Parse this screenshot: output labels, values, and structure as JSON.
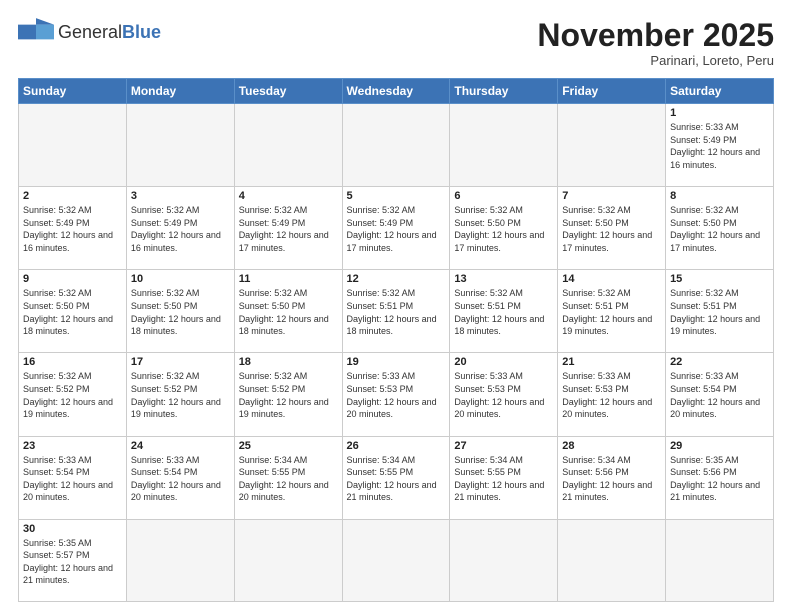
{
  "header": {
    "logo_general": "General",
    "logo_blue": "Blue",
    "month_year": "November 2025",
    "location": "Parinari, Loreto, Peru"
  },
  "weekdays": [
    "Sunday",
    "Monday",
    "Tuesday",
    "Wednesday",
    "Thursday",
    "Friday",
    "Saturday"
  ],
  "weeks": [
    [
      {
        "day": "",
        "info": "",
        "empty": true
      },
      {
        "day": "",
        "info": "",
        "empty": true
      },
      {
        "day": "",
        "info": "",
        "empty": true
      },
      {
        "day": "",
        "info": "",
        "empty": true
      },
      {
        "day": "",
        "info": "",
        "empty": true
      },
      {
        "day": "",
        "info": "",
        "empty": true
      },
      {
        "day": "1",
        "info": "Sunrise: 5:33 AM\nSunset: 5:49 PM\nDaylight: 12 hours and 16 minutes."
      }
    ],
    [
      {
        "day": "2",
        "info": "Sunrise: 5:32 AM\nSunset: 5:49 PM\nDaylight: 12 hours and 16 minutes."
      },
      {
        "day": "3",
        "info": "Sunrise: 5:32 AM\nSunset: 5:49 PM\nDaylight: 12 hours and 16 minutes."
      },
      {
        "day": "4",
        "info": "Sunrise: 5:32 AM\nSunset: 5:49 PM\nDaylight: 12 hours and 17 minutes."
      },
      {
        "day": "5",
        "info": "Sunrise: 5:32 AM\nSunset: 5:49 PM\nDaylight: 12 hours and 17 minutes."
      },
      {
        "day": "6",
        "info": "Sunrise: 5:32 AM\nSunset: 5:50 PM\nDaylight: 12 hours and 17 minutes."
      },
      {
        "day": "7",
        "info": "Sunrise: 5:32 AM\nSunset: 5:50 PM\nDaylight: 12 hours and 17 minutes."
      },
      {
        "day": "8",
        "info": "Sunrise: 5:32 AM\nSunset: 5:50 PM\nDaylight: 12 hours and 17 minutes."
      }
    ],
    [
      {
        "day": "9",
        "info": "Sunrise: 5:32 AM\nSunset: 5:50 PM\nDaylight: 12 hours and 18 minutes."
      },
      {
        "day": "10",
        "info": "Sunrise: 5:32 AM\nSunset: 5:50 PM\nDaylight: 12 hours and 18 minutes."
      },
      {
        "day": "11",
        "info": "Sunrise: 5:32 AM\nSunset: 5:50 PM\nDaylight: 12 hours and 18 minutes."
      },
      {
        "day": "12",
        "info": "Sunrise: 5:32 AM\nSunset: 5:51 PM\nDaylight: 12 hours and 18 minutes."
      },
      {
        "day": "13",
        "info": "Sunrise: 5:32 AM\nSunset: 5:51 PM\nDaylight: 12 hours and 18 minutes."
      },
      {
        "day": "14",
        "info": "Sunrise: 5:32 AM\nSunset: 5:51 PM\nDaylight: 12 hours and 19 minutes."
      },
      {
        "day": "15",
        "info": "Sunrise: 5:32 AM\nSunset: 5:51 PM\nDaylight: 12 hours and 19 minutes."
      }
    ],
    [
      {
        "day": "16",
        "info": "Sunrise: 5:32 AM\nSunset: 5:52 PM\nDaylight: 12 hours and 19 minutes."
      },
      {
        "day": "17",
        "info": "Sunrise: 5:32 AM\nSunset: 5:52 PM\nDaylight: 12 hours and 19 minutes."
      },
      {
        "day": "18",
        "info": "Sunrise: 5:32 AM\nSunset: 5:52 PM\nDaylight: 12 hours and 19 minutes."
      },
      {
        "day": "19",
        "info": "Sunrise: 5:33 AM\nSunset: 5:53 PM\nDaylight: 12 hours and 20 minutes."
      },
      {
        "day": "20",
        "info": "Sunrise: 5:33 AM\nSunset: 5:53 PM\nDaylight: 12 hours and 20 minutes."
      },
      {
        "day": "21",
        "info": "Sunrise: 5:33 AM\nSunset: 5:53 PM\nDaylight: 12 hours and 20 minutes."
      },
      {
        "day": "22",
        "info": "Sunrise: 5:33 AM\nSunset: 5:54 PM\nDaylight: 12 hours and 20 minutes."
      }
    ],
    [
      {
        "day": "23",
        "info": "Sunrise: 5:33 AM\nSunset: 5:54 PM\nDaylight: 12 hours and 20 minutes."
      },
      {
        "day": "24",
        "info": "Sunrise: 5:33 AM\nSunset: 5:54 PM\nDaylight: 12 hours and 20 minutes."
      },
      {
        "day": "25",
        "info": "Sunrise: 5:34 AM\nSunset: 5:55 PM\nDaylight: 12 hours and 20 minutes."
      },
      {
        "day": "26",
        "info": "Sunrise: 5:34 AM\nSunset: 5:55 PM\nDaylight: 12 hours and 21 minutes."
      },
      {
        "day": "27",
        "info": "Sunrise: 5:34 AM\nSunset: 5:55 PM\nDaylight: 12 hours and 21 minutes."
      },
      {
        "day": "28",
        "info": "Sunrise: 5:34 AM\nSunset: 5:56 PM\nDaylight: 12 hours and 21 minutes."
      },
      {
        "day": "29",
        "info": "Sunrise: 5:35 AM\nSunset: 5:56 PM\nDaylight: 12 hours and 21 minutes."
      }
    ],
    [
      {
        "day": "30",
        "info": "Sunrise: 5:35 AM\nSunset: 5:57 PM\nDaylight: 12 hours and 21 minutes.",
        "last": true
      },
      {
        "day": "",
        "info": "",
        "empty": true,
        "last": true
      },
      {
        "day": "",
        "info": "",
        "empty": true,
        "last": true
      },
      {
        "day": "",
        "info": "",
        "empty": true,
        "last": true
      },
      {
        "day": "",
        "info": "",
        "empty": true,
        "last": true
      },
      {
        "day": "",
        "info": "",
        "empty": true,
        "last": true
      },
      {
        "day": "",
        "info": "",
        "empty": true,
        "last": true
      }
    ]
  ]
}
